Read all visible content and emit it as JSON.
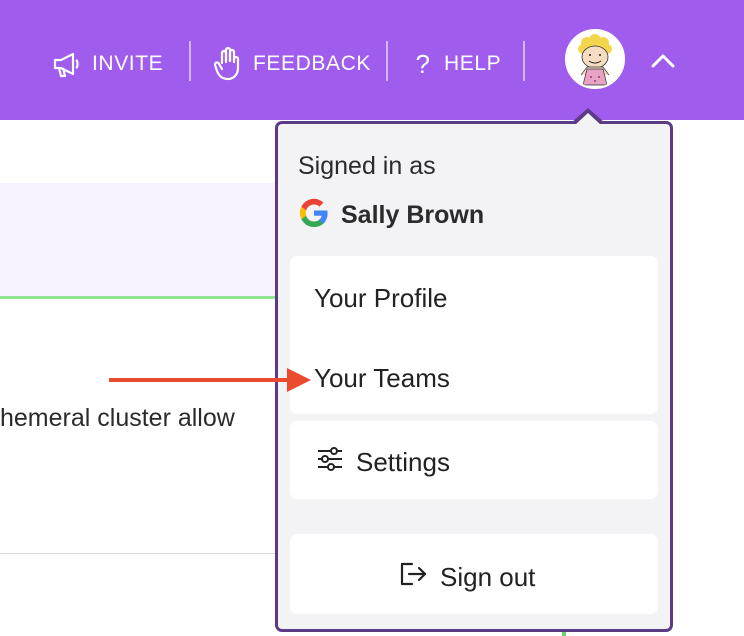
{
  "header": {
    "invite_label": "INVITE",
    "feedback_label": "FEEDBACK",
    "help_label": "HELP",
    "avatar_icon": "peanuts-character-avatar",
    "chevron_icon": "chevron-up-icon",
    "background_color": "#a05cec"
  },
  "background": {
    "body_text": "hemeral cluster allow"
  },
  "account_menu": {
    "signed_in_label": "Signed in as",
    "provider_icon": "google-icon",
    "user_name": "Sally Brown",
    "items": [
      {
        "label": "Your Profile"
      },
      {
        "label": "Your Teams"
      },
      {
        "label": "Settings",
        "icon": "sliders-icon"
      }
    ],
    "sign_out_label": "Sign out",
    "sign_out_icon": "sign-out-icon",
    "border_color": "#5b3a86"
  },
  "annotation": {
    "arrow_color": "#ea4a2e",
    "points_to": "Your Teams"
  }
}
